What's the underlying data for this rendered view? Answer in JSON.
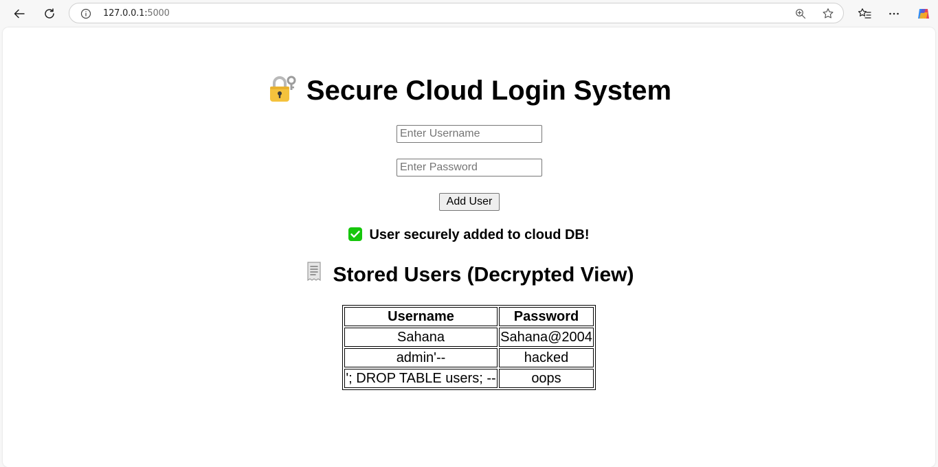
{
  "browser": {
    "url_host": "127.0.0.1:",
    "url_port": "5000"
  },
  "page": {
    "title": "Secure Cloud Login System",
    "title_icon": "locked-with-key-icon",
    "username_placeholder": "Enter Username",
    "password_placeholder": "Enter Password",
    "add_button_label": "Add User",
    "status_icon": "check-mark-button-icon",
    "status_message": "User securely added to cloud DB!",
    "stored_heading": "Stored Users (Decrypted View)",
    "stored_heading_icon": "receipt-icon",
    "table": {
      "headers": [
        "Username",
        "Password"
      ],
      "rows": [
        [
          "Sahana",
          "Sahana@2004"
        ],
        [
          "admin'--",
          "hacked"
        ],
        [
          "'; DROP TABLE users; --",
          "oops"
        ]
      ]
    }
  },
  "colors": {
    "status_check": "#16c60c",
    "lock_body": "#f4c23d",
    "accent_browser": "#1f1f1f"
  }
}
